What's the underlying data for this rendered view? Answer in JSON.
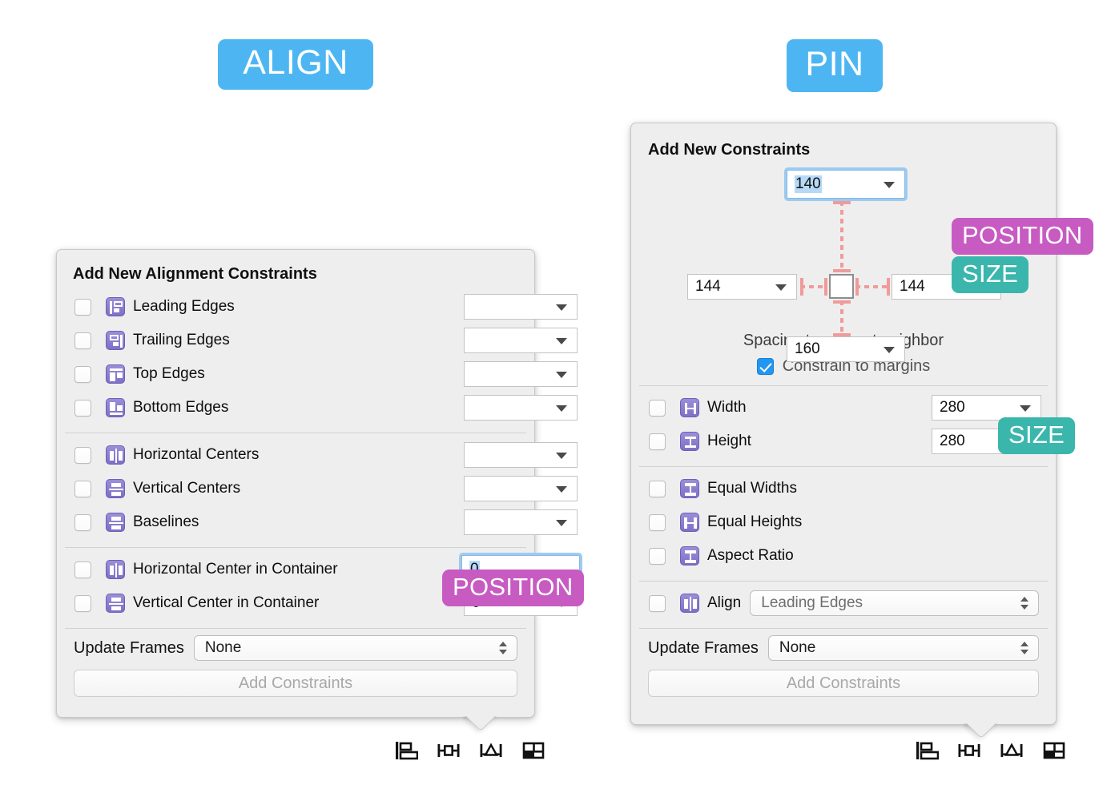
{
  "badges": {
    "align": "ALIGN",
    "pin": "PIN",
    "color": "#4DB6F2"
  },
  "annotations": {
    "position": "POSITION",
    "size": "SIZE",
    "position_color": "#C75BC2",
    "size_color": "#3BB6AC"
  },
  "align_panel": {
    "title": "Add New Alignment Constraints",
    "edge_rows": [
      {
        "icon": "leading-edges-icon",
        "label": "Leading Edges",
        "value": "",
        "checked": false
      },
      {
        "icon": "trailing-edges-icon",
        "label": "Trailing Edges",
        "value": "",
        "checked": false
      },
      {
        "icon": "top-edges-icon",
        "label": "Top Edges",
        "value": "",
        "checked": false
      },
      {
        "icon": "bottom-edges-icon",
        "label": "Bottom Edges",
        "value": "",
        "checked": false
      }
    ],
    "center_rows": [
      {
        "icon": "horizontal-centers-icon",
        "label": "Horizontal Centers",
        "value": "",
        "checked": false
      },
      {
        "icon": "vertical-centers-icon",
        "label": "Vertical Centers",
        "value": "",
        "checked": false
      },
      {
        "icon": "baselines-icon",
        "label": "Baselines",
        "value": "",
        "checked": false
      }
    ],
    "container_rows": [
      {
        "icon": "horizontal-center-in-container-icon",
        "label": "Horizontal Center in Container",
        "value": "0",
        "checked": false,
        "focused": true
      },
      {
        "icon": "vertical-center-in-container-icon",
        "label": "Vertical Center in Container",
        "value": "0",
        "checked": false,
        "focused": false
      }
    ],
    "update_frames_label": "Update Frames",
    "update_frames_value": "None",
    "add_constraints_label": "Add Constraints"
  },
  "pin_panel": {
    "title": "Add New Constraints",
    "spacing": {
      "top": "140",
      "left": "144",
      "right": "144",
      "bottom": "160",
      "note": "Spacing to nearest neighbor",
      "constrain_to_margins_label": "Constrain to margins",
      "constrain_to_margins_checked": true
    },
    "size_rows": [
      {
        "icon": "width-icon",
        "label": "Width",
        "value": "280",
        "checked": false
      },
      {
        "icon": "height-icon",
        "label": "Height",
        "value": "280",
        "checked": false
      }
    ],
    "equal_rows": [
      {
        "icon": "equal-widths-icon",
        "label": "Equal Widths",
        "checked": false
      },
      {
        "icon": "equal-heights-icon",
        "label": "Equal Heights",
        "checked": false
      },
      {
        "icon": "aspect-ratio-icon",
        "label": "Aspect Ratio",
        "checked": false
      }
    ],
    "align_row": {
      "icon": "align-icon",
      "label": "Align",
      "value": "Leading Edges",
      "checked": false
    },
    "update_frames_label": "Update Frames",
    "update_frames_value": "None",
    "add_constraints_label": "Add Constraints"
  },
  "toolbar": {
    "items": [
      {
        "name": "align-tool-icon",
        "title": "Align"
      },
      {
        "name": "pin-tool-icon",
        "title": "Pin"
      },
      {
        "name": "resolve-tool-icon",
        "title": "Resolve Auto Layout Issues"
      },
      {
        "name": "stack-tool-icon",
        "title": "Embed In Stack"
      }
    ]
  }
}
